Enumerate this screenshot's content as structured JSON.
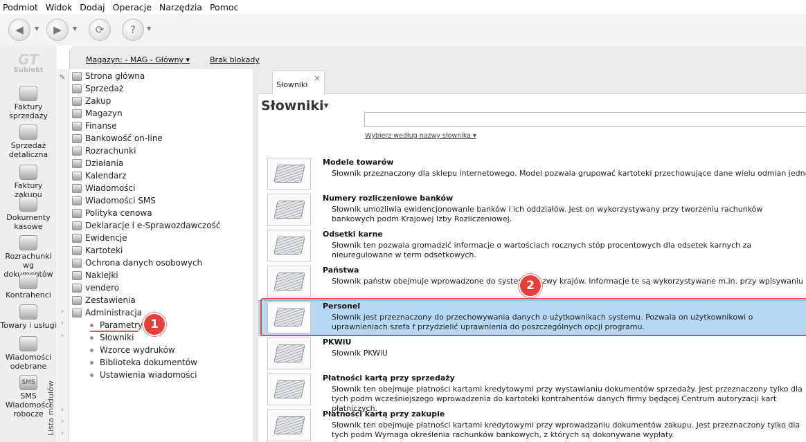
{
  "menu": [
    "Podmiot",
    "Widok",
    "Dodaj",
    "Operacje",
    "Narzędzia",
    "Pomoc"
  ],
  "toolbar": {
    "buttons": [
      "back-icon",
      "forward-icon",
      "refresh-icon",
      "help-icon"
    ]
  },
  "rail": {
    "logo": "Subiekt",
    "items": [
      {
        "label": "Faktury sprzedaży",
        "icon": "coins-icon"
      },
      {
        "label": "Sprzedaż detaliczna",
        "icon": "shop-icon"
      },
      {
        "label": "Faktury zakupu",
        "icon": "cart-icon"
      },
      {
        "label": "Dokumenty kasowe",
        "icon": "cash-icon"
      },
      {
        "label": "Rozrachunki wg dokumentów",
        "icon": "settlement-icon"
      },
      {
        "label": "Kontrahenci",
        "icon": "person-icon"
      },
      {
        "label": "Towary i usługi",
        "icon": "goods-icon"
      },
      {
        "label": "Wiadomości odebrane",
        "icon": "mail-icon"
      },
      {
        "label": "SMS Wiadomości robocze",
        "icon": "sms-icon",
        "badge": "SMS"
      }
    ]
  },
  "topbar": {
    "magazyn": "Magazyn: - MAG - Główny ▾",
    "blokada": "Brak blokady"
  },
  "modules_label": "Lista modułów",
  "tree": {
    "nodes": [
      "Strona główna",
      "Sprzedaż",
      "Zakup",
      "Magazyn",
      "Finanse",
      "Bankowość on-line",
      "Rozrachunki",
      "Działania",
      "Kalendarz",
      "Wiadomości",
      "Wiadomości SMS",
      "Polityka cenowa",
      "Deklaracje i e-Sprawozdawczość",
      "Ewidencje",
      "Kartoteki",
      "Ochrona danych osobowych",
      "Naklejki",
      "vendero",
      "Zestawienia",
      "Administracja"
    ],
    "sub": [
      "Parametry",
      "Słowniki",
      "Wzorce wydruków",
      "Biblioteka dokumentów",
      "Ustawienia wiadomości"
    ]
  },
  "badges": {
    "one": "1",
    "two": "2"
  },
  "right": {
    "tab": "Słowniki",
    "tab_close": "×",
    "title": "Słowniki",
    "search_value": "",
    "select_label": "Wybierz według nazwy słownika ▾",
    "entries": [
      {
        "title": "Modele towarów",
        "desc": "Słownik przeznaczony dla sklepu internetowego. Model pozwala grupować kartoteki przechowujące dane wielu odmian jednego tow"
      },
      {
        "title": "Numery rozliczeniowe banków",
        "desc": "Słownik umożliwia ewidencjonowanie banków i ich oddziałów. Jest on wykorzystywany przy tworzeniu rachunków bankowych podm Krajowej Izby Rozliczeniowej."
      },
      {
        "title": "Odsetki karne",
        "desc": "Słownik ten pozwala gromadzić informacje o wartościach rocznych stóp procentowych dla odsetek karnych za nieuregulowane w term odsetkowych."
      },
      {
        "title": "Państwa",
        "desc": "Słownik państw obejmuje wprowadzone do systemu nazwy krajów. Informacje te są wykorzystywane m.in. przy wpisywaniu danych ad"
      },
      {
        "title": "Personel",
        "desc": "Słownik jest przeznaczony do przechowywania danych o użytkownikach systemu. Pozwala on użytkownikowi o uprawnieniach szefa f przydzielić uprawnienia do poszczególnych opcji programu."
      },
      {
        "title": "PKWiU",
        "desc": "Słownik PKWiU"
      },
      {
        "title": "Płatności kartą przy sprzedaży",
        "desc": "Słownik ten obejmuje płatności kartami kredytowymi przy wystawianiu dokumentów sprzedaży. Jest przeznaczony tylko dla tych podm wcześniejszego wprowadzenia do kartoteki kontrahentów danych firmy będącej Centrum autoryzacji kart płatniczych."
      },
      {
        "title": "Płatności kartą przy zakupie",
        "desc": "Słownik ten obejmuje płatności kartami kredytowymi przy wprowadzaniu dokumentów zakupu. Jest przeznaczony tylko dla tych podm Wymaga określenia rachunków bankowych, z których są dokonywane wypłaty."
      }
    ]
  }
}
